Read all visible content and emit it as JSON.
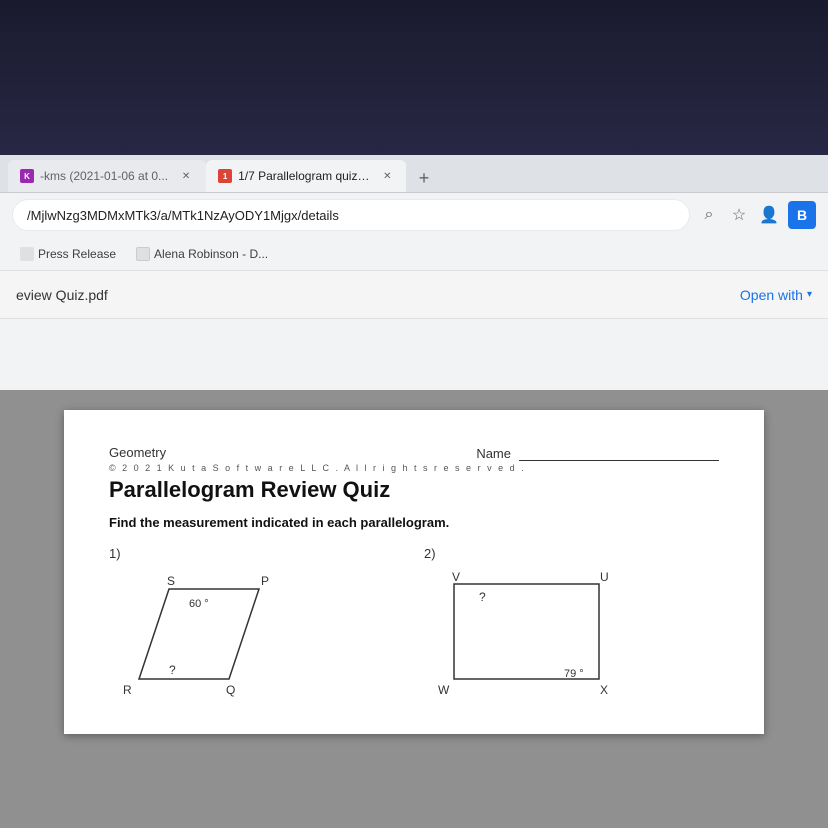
{
  "browser": {
    "tabs": [
      {
        "id": "tab1",
        "label": "-kms (2021-01-06 at 0...",
        "active": false,
        "favicon_color": "#9c27b0"
      },
      {
        "id": "tab2",
        "label": "1/7 Parallelogram quiz review",
        "active": true,
        "favicon_color": "#db4437",
        "favicon_letter": "1"
      }
    ],
    "new_tab_label": "+",
    "address_bar": {
      "url": "/MjlwNzg3MDMxMTk3/a/MTk1NzAyODY1Mjgx/details"
    },
    "actions": {
      "search": "⌕",
      "star": "☆",
      "profile": "👤",
      "b_label": "B"
    }
  },
  "bookmarks": [
    {
      "label": "Press Release"
    },
    {
      "label": "Alena Robinson - D..."
    }
  ],
  "pdf_toolbar": {
    "filename": "eview Quiz.pdf",
    "open_with_label": "Open with",
    "open_with_arrow": "▾"
  },
  "pdf_content": {
    "header_left": "Geometry",
    "header_right_label": "Name",
    "copyright": "© 2 0 2 1   K u t a   S o f t w a r e   L L C .   A l l   r i g h t s   r e s e r v e d .",
    "title": "Parallelogram Review  Quiz",
    "instruction": "Find the measurement indicated in each parallelogram.",
    "problems": [
      {
        "number": "1)",
        "vertices": {
          "S": "S",
          "P": "P",
          "Q": "Q",
          "R": "R"
        },
        "angle": "60 °",
        "unknown": "?"
      },
      {
        "number": "2)",
        "vertices": {
          "V": "V",
          "U": "U",
          "W": "W",
          "X": "X"
        },
        "angle": "79 °",
        "unknown": "?"
      }
    ]
  }
}
